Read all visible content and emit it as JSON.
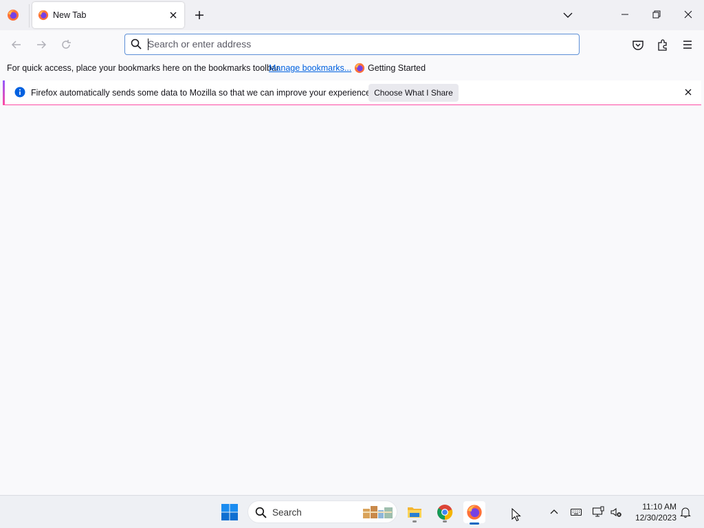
{
  "browser": {
    "tab": {
      "title": "New Tab"
    },
    "urlbar": {
      "placeholder": "Search or enter address",
      "value": ""
    },
    "bookmarks_bar": {
      "message": "For quick access, place your bookmarks here on the bookmarks toolbar.",
      "manage_link": "Manage bookmarks...",
      "items": [
        {
          "label": "Getting Started"
        }
      ]
    },
    "notification": {
      "message": "Firefox automatically sends some data to Mozilla so that we can improve your experience.",
      "button": "Choose What I Share"
    }
  },
  "taskbar": {
    "search_label": "Search",
    "apps": [
      {
        "icon": "file-explorer-icon"
      },
      {
        "icon": "chrome-icon"
      },
      {
        "icon": "firefox-icon",
        "active": true
      }
    ],
    "clock": {
      "time": "11:10 AM",
      "date": "12/30/2023"
    }
  },
  "colors": {
    "accent": "#0061e0",
    "urlbar_focus": "#5b8ed6",
    "taskbar_active": "#0067c0"
  }
}
